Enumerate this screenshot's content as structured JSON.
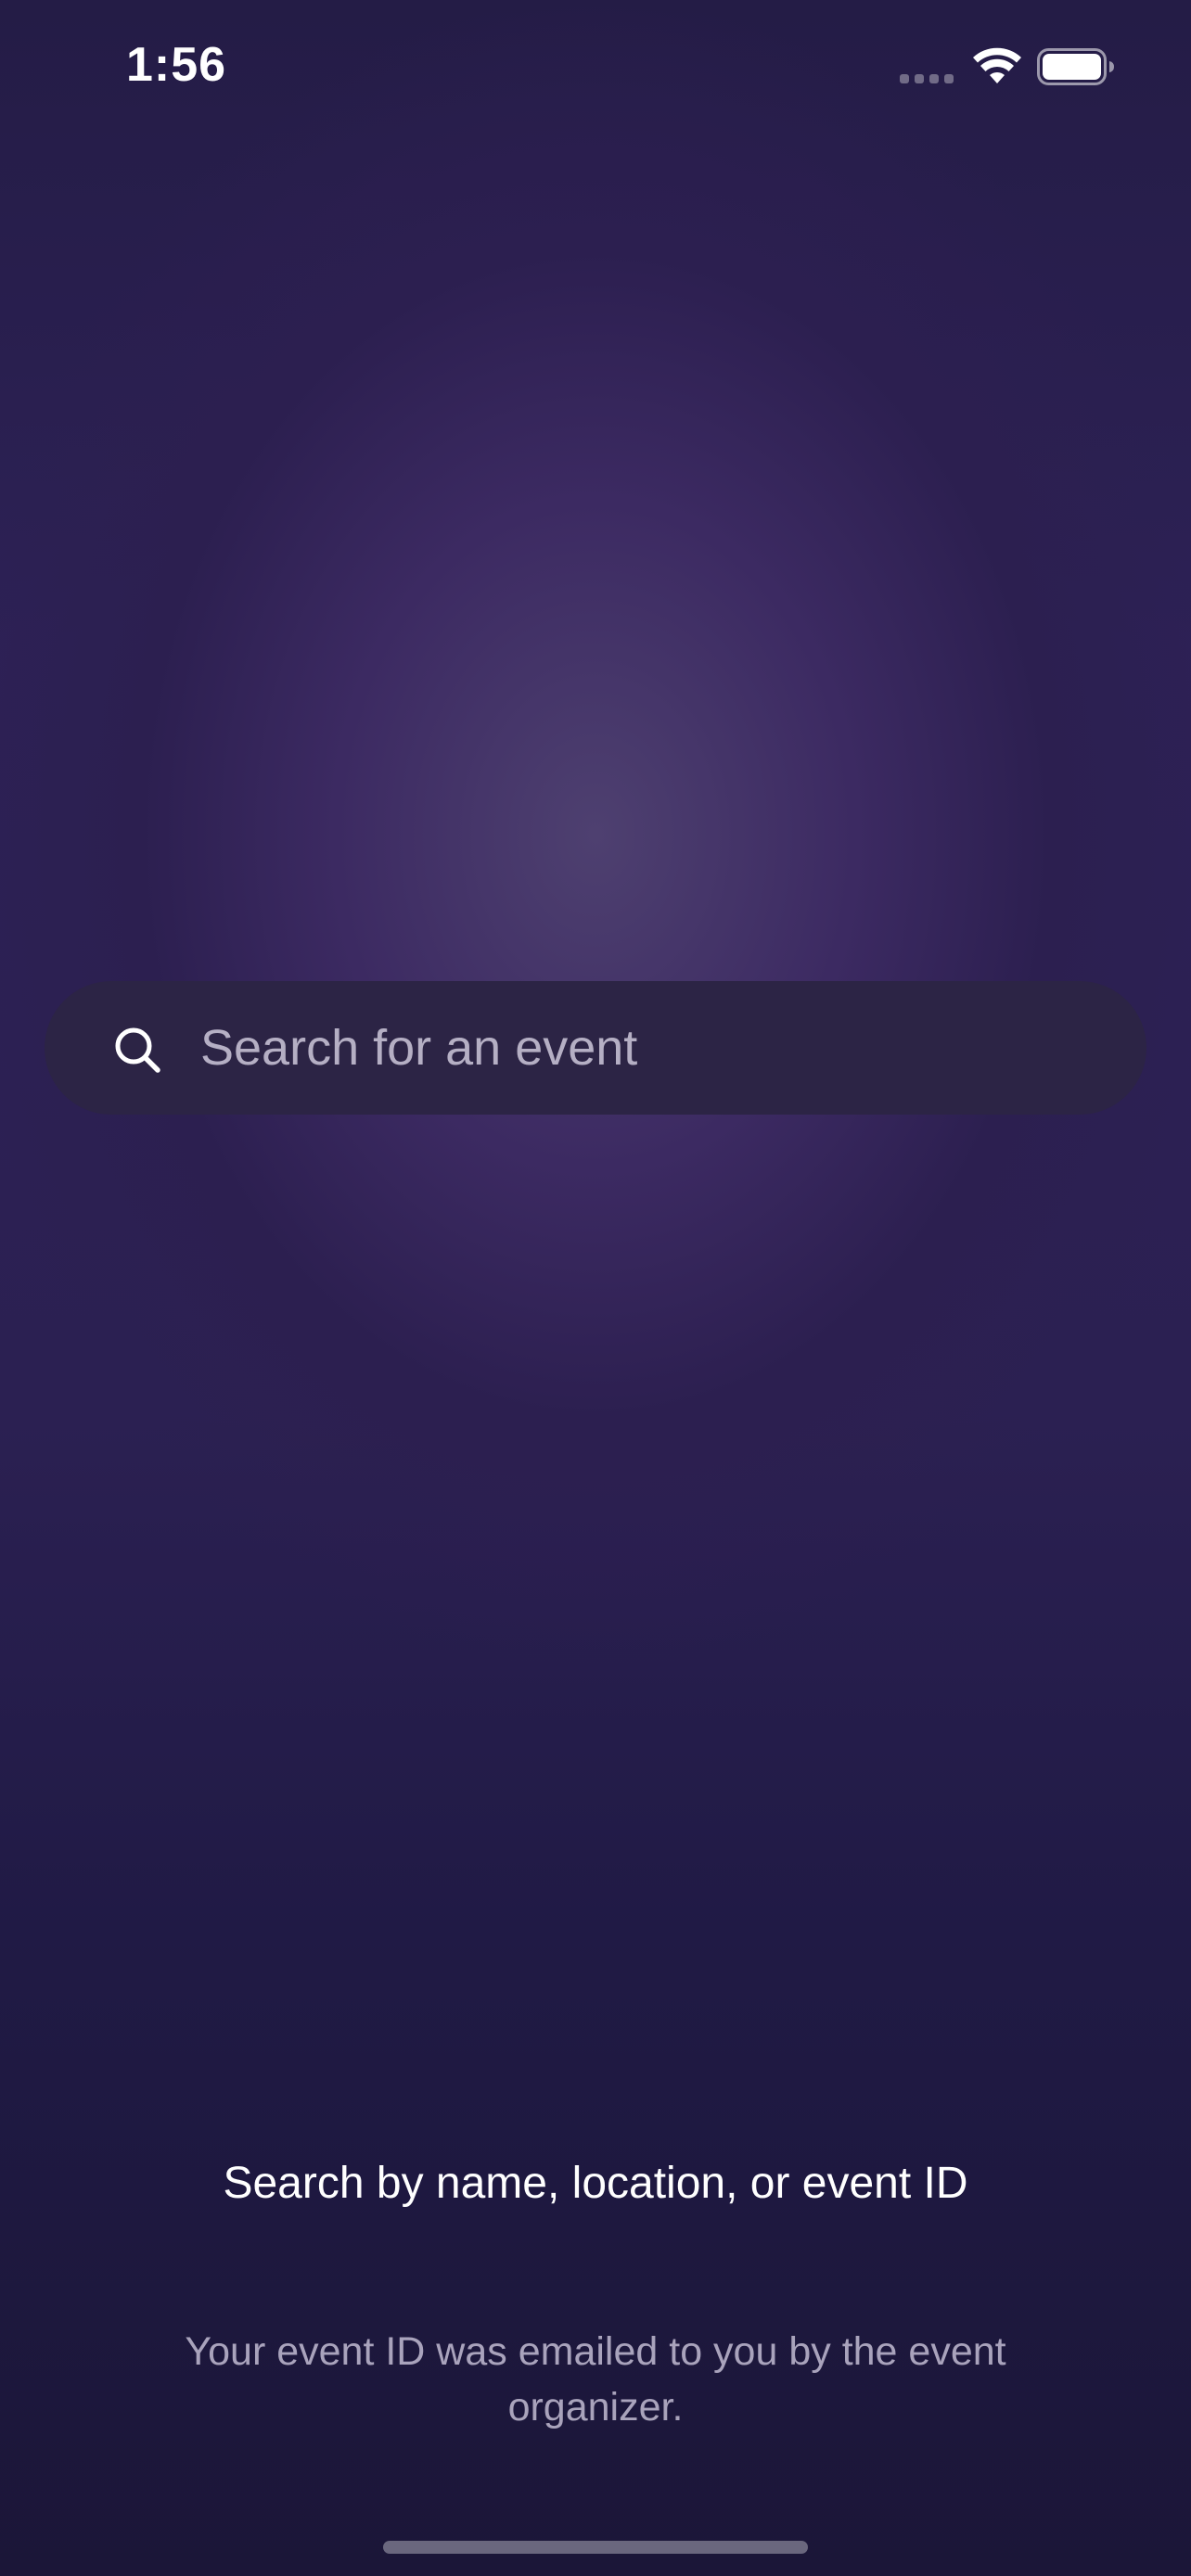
{
  "status_bar": {
    "time": "1:56",
    "icons": [
      "cellular-signal-icon",
      "wifi-icon",
      "battery-icon"
    ]
  },
  "search": {
    "placeholder": "Search for an event",
    "value": "",
    "icon": "search-icon"
  },
  "hints": {
    "title": "Search by name, location, or event ID",
    "subtitle": "Your event ID was emailed to you by the event organizer."
  },
  "colors": {
    "background_top": "#241c46",
    "background_glow": "#4e4070",
    "background_bottom": "#1b1638",
    "search_bar_fill": "#2c2445",
    "text_primary": "#ffffff",
    "text_secondary": "#c8c2d8"
  }
}
